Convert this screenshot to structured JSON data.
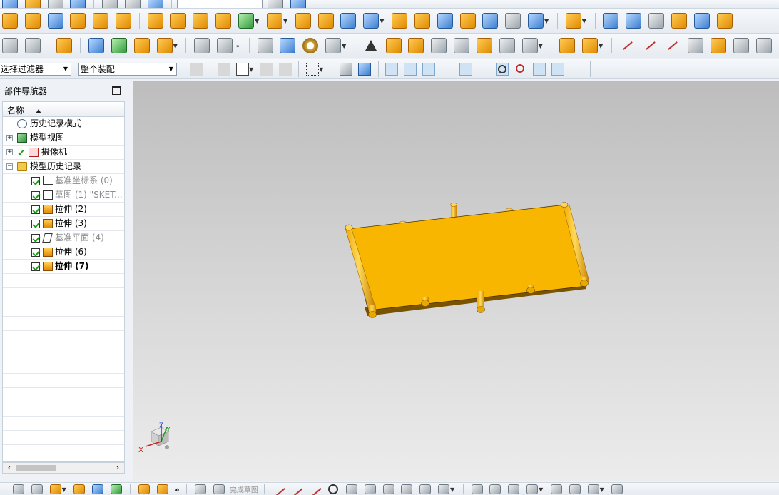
{
  "toolbar": {
    "more_label": "»"
  },
  "filter_bar": {
    "selection_filter": "选择过滤器",
    "assembly_scope": "整个装配"
  },
  "navigator": {
    "title": "部件导航器",
    "column_name": "名称",
    "items": [
      {
        "label": "历史记录模式",
        "level": 0,
        "icon": "history-clock-icon"
      },
      {
        "label": "模型视图",
        "level": 0,
        "icon": "model-view-icon",
        "expandable": true
      },
      {
        "label": "摄像机",
        "level": 0,
        "icon": "camera-icon",
        "expandable": true,
        "checked": true
      },
      {
        "label": "模型历史记录",
        "level": 0,
        "icon": "folder-icon",
        "expanded": true
      },
      {
        "label": "基准坐标系 (0)",
        "level": 1,
        "icon": "datum-csys-icon",
        "dim": true
      },
      {
        "label": "草图 (1) \"SKET...",
        "level": 1,
        "icon": "sketch-icon",
        "dim": true
      },
      {
        "label": "拉伸 (2)",
        "level": 1,
        "icon": "extrude-icon"
      },
      {
        "label": "拉伸 (3)",
        "level": 1,
        "icon": "extrude-icon"
      },
      {
        "label": "基准平面 (4)",
        "level": 1,
        "icon": "datum-plane-icon",
        "dim": true
      },
      {
        "label": "拉伸 (6)",
        "level": 1,
        "icon": "extrude-icon"
      },
      {
        "label": "拉伸 (7)",
        "level": 1,
        "icon": "extrude-icon",
        "bold": true
      }
    ]
  },
  "viewport": {
    "model_color": "#F9B600",
    "background_top": "#bdbdbd",
    "background_bottom": "#ececec",
    "triad": {
      "x_label": "X",
      "y_label": "Y",
      "z_label": "Z"
    }
  },
  "bottom_bar": {
    "finish_sketch_label": "完成草图",
    "more_label": "»"
  }
}
